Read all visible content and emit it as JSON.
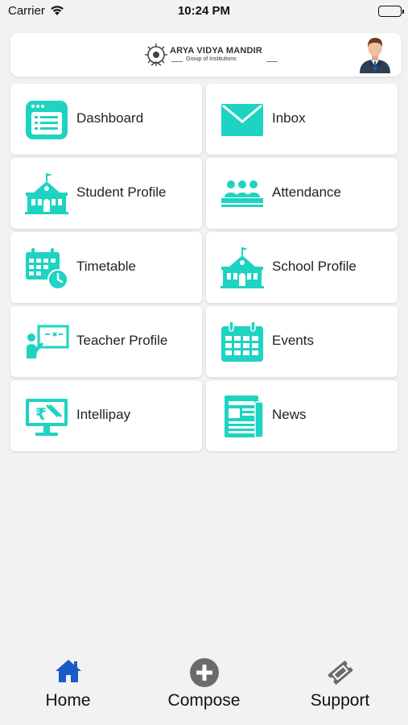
{
  "status_bar": {
    "carrier": "Carrier",
    "time": "10:24 PM"
  },
  "header": {
    "logo_name": "ARYA VIDYA MANDIR",
    "logo_subtitle": "Group of Institutions"
  },
  "colors": {
    "accent": "#1dd3c2",
    "tab_active": "#1a5cc7",
    "tab_inactive": "#6b6b6b"
  },
  "menu": [
    {
      "label": "Dashboard",
      "icon": "dashboard-icon"
    },
    {
      "label": "Inbox",
      "icon": "envelope-icon"
    },
    {
      "label": "Student Profile",
      "icon": "school-building-icon"
    },
    {
      "label": "Attendance",
      "icon": "group-seated-icon"
    },
    {
      "label": "Timetable",
      "icon": "calendar-clock-icon"
    },
    {
      "label": "School Profile",
      "icon": "school-building-icon"
    },
    {
      "label": "Teacher Profile",
      "icon": "teacher-board-icon"
    },
    {
      "label": "Events",
      "icon": "calendar-icon"
    },
    {
      "label": "Intellipay",
      "icon": "payment-monitor-icon"
    },
    {
      "label": "News",
      "icon": "newspaper-icon"
    }
  ],
  "tabs": [
    {
      "label": "Home",
      "icon": "home-icon",
      "active": true
    },
    {
      "label": "Compose",
      "icon": "plus-circle-icon",
      "active": false
    },
    {
      "label": "Support",
      "icon": "ticket-icon",
      "active": false
    }
  ]
}
